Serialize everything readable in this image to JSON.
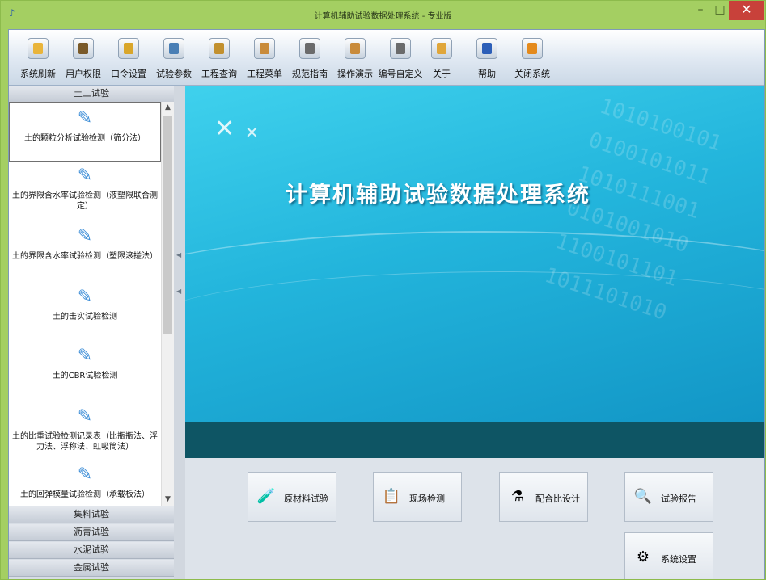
{
  "window": {
    "title": "计算机辅助试验数据处理系统 - 专业版",
    "minimize": "–",
    "maximize": "□",
    "close": "✕"
  },
  "toolbar": {
    "items": [
      {
        "label": "系统刷新",
        "icon": "refresh-icon",
        "color": "#e9b43a"
      },
      {
        "label": "用户权限",
        "icon": "user-permission-icon",
        "color": "#7a5a2a"
      },
      {
        "label": "口令设置",
        "icon": "password-icon",
        "color": "#d9a62a"
      },
      {
        "label": "试验参数",
        "icon": "test-params-icon",
        "color": "#4a7fb5"
      },
      {
        "label": "工程查询",
        "icon": "project-search-icon",
        "color": "#c2902e"
      },
      {
        "label": "工程菜单",
        "icon": "project-menu-icon",
        "color": "#c98b3a"
      },
      {
        "label": "规范指南",
        "icon": "spec-guide-icon",
        "color": "#6b6b6b"
      },
      {
        "label": "操作演示",
        "icon": "demo-icon",
        "color": "#c98b3a"
      },
      {
        "label": "编号自定义",
        "icon": "numbering-icon",
        "color": "#6b6b6b"
      },
      {
        "label": "关于",
        "icon": "about-icon",
        "color": "#e0a63a"
      },
      {
        "label": "帮助",
        "icon": "help-icon",
        "color": "#2d5fb8"
      },
      {
        "label": "关闭系统",
        "icon": "exit-icon",
        "color": "#e48a1c"
      }
    ]
  },
  "left_panel": {
    "active_category": "土工试验",
    "items": [
      {
        "label": "土的颗粒分析试验检测（筛分法）"
      },
      {
        "label": "土的界限含水率试验检测（液塑限联合测定）"
      },
      {
        "label": "土的界限含水率试验检测（塑限滚搓法）"
      },
      {
        "label": "土的击实试验检测"
      },
      {
        "label": "土的CBR试验检测"
      },
      {
        "label": "土的比重试验检测记录表（比瓶瓶法、浮力法、浮称法、虹吸筒法）"
      },
      {
        "label": "土的回弹模量试验检测（承载板法）"
      }
    ],
    "categories": [
      {
        "label": "集料试验"
      },
      {
        "label": "沥青试验"
      },
      {
        "label": "水泥试验"
      },
      {
        "label": "金属试验"
      }
    ]
  },
  "banner": {
    "title": "计算机辅助试验数据处理系统",
    "digits": [
      "1010100101",
      "0100101011",
      "1010111001",
      "0101001010",
      "1100101101",
      "1011101010"
    ]
  },
  "actions": [
    {
      "label": "原材料试验",
      "icon": "raw-material-icon",
      "glyph": "🧪"
    },
    {
      "label": "现场检测",
      "icon": "field-test-icon",
      "glyph": "📋"
    },
    {
      "label": "配合比设计",
      "icon": "mix-design-icon",
      "glyph": "⚗"
    },
    {
      "label": "试验报告",
      "icon": "report-icon",
      "glyph": "🔍"
    },
    {
      "label": "系统设置",
      "icon": "settings-icon",
      "glyph": "⚙"
    }
  ]
}
